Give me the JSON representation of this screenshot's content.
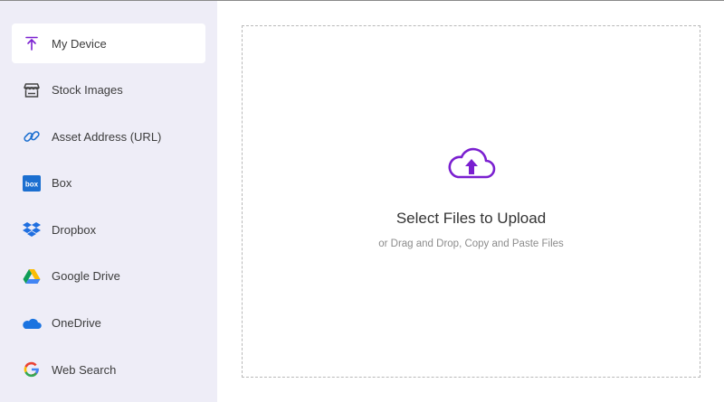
{
  "sidebar": {
    "items": [
      {
        "label": "My Device",
        "icon": "upload-arrow-icon",
        "active": true
      },
      {
        "label": "Stock Images",
        "icon": "storefront-icon",
        "active": false
      },
      {
        "label": "Asset Address (URL)",
        "icon": "link-icon",
        "active": false
      },
      {
        "label": "Box",
        "icon": "box-logo-icon",
        "active": false
      },
      {
        "label": "Dropbox",
        "icon": "dropbox-logo-icon",
        "active": false
      },
      {
        "label": "Google Drive",
        "icon": "google-drive-logo-icon",
        "active": false
      },
      {
        "label": "OneDrive",
        "icon": "onedrive-logo-icon",
        "active": false
      },
      {
        "label": "Web Search",
        "icon": "google-logo-icon",
        "active": false
      }
    ]
  },
  "dropzone": {
    "title": "Select Files to Upload",
    "subtitle": "or Drag and Drop, Copy and Paste Files",
    "icon": "cloud-upload-icon"
  },
  "colors": {
    "accent": "#7a1fd0",
    "sidebar_bg": "#eeedf7",
    "box_blue": "#1b6fd0",
    "dropbox_blue": "#1f6fe0",
    "onedrive_blue": "#1a73e0"
  }
}
